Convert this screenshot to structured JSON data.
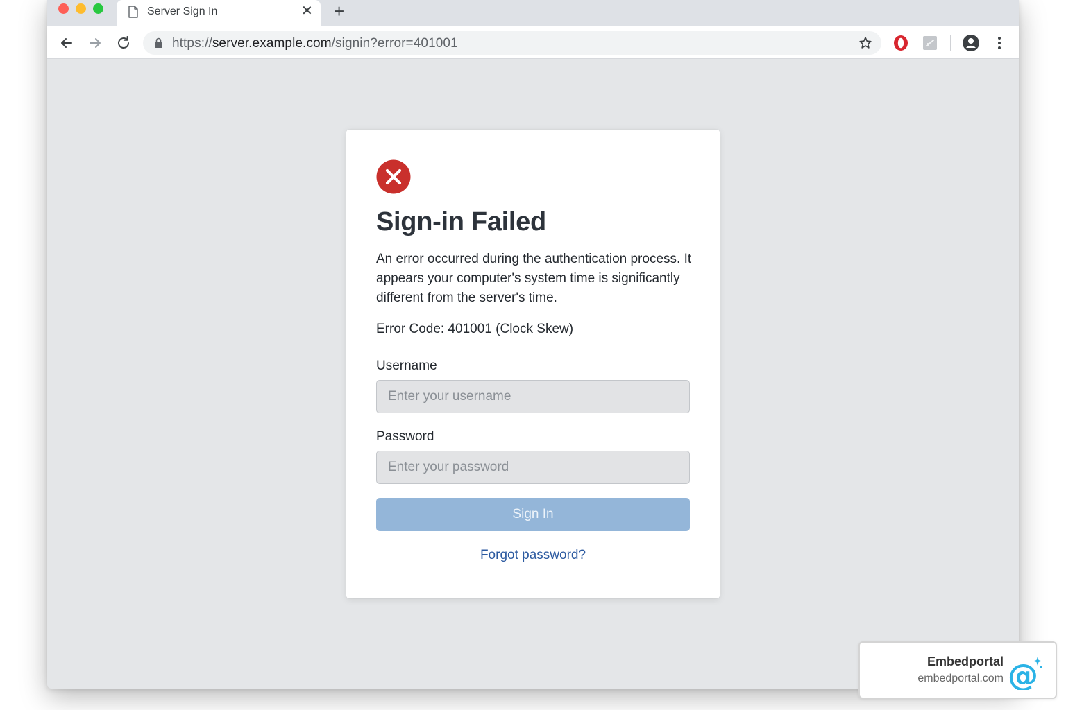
{
  "browser": {
    "tab_title": "Server Sign In",
    "tab_icon": "document-icon",
    "url_scheme": "https://",
    "url_host": "server.example.com",
    "url_path": "/signin?error=401001",
    "icons": [
      "back-arrow-icon",
      "forward-arrow-icon",
      "reload-icon",
      "lock-icon",
      "bookmark-star-icon",
      "opera-extension-icon",
      "puzzle-extension-icon",
      "profile-icon",
      "more-menu-icon"
    ]
  },
  "card": {
    "title": "Sign-in Failed",
    "message": "An error occurred during the authentication process. It appears your computer's system time is significantly different from the server's time.",
    "error_code": "Error Code: 401001 (Clock Skew)",
    "username_label": "Username",
    "username_placeholder": "Enter your username",
    "password_label": "Password",
    "password_placeholder": "Enter your password",
    "signin_label": "Sign In",
    "forgot_label": "Forgot password?"
  },
  "watermark": {
    "name": "Embedportal",
    "domain": "embedportal.com"
  },
  "colors": {
    "error_red": "#c9302c",
    "button_blue": "#94b6d9",
    "link_blue": "#2c5aa0",
    "badge_cyan": "#2bb3e6"
  }
}
